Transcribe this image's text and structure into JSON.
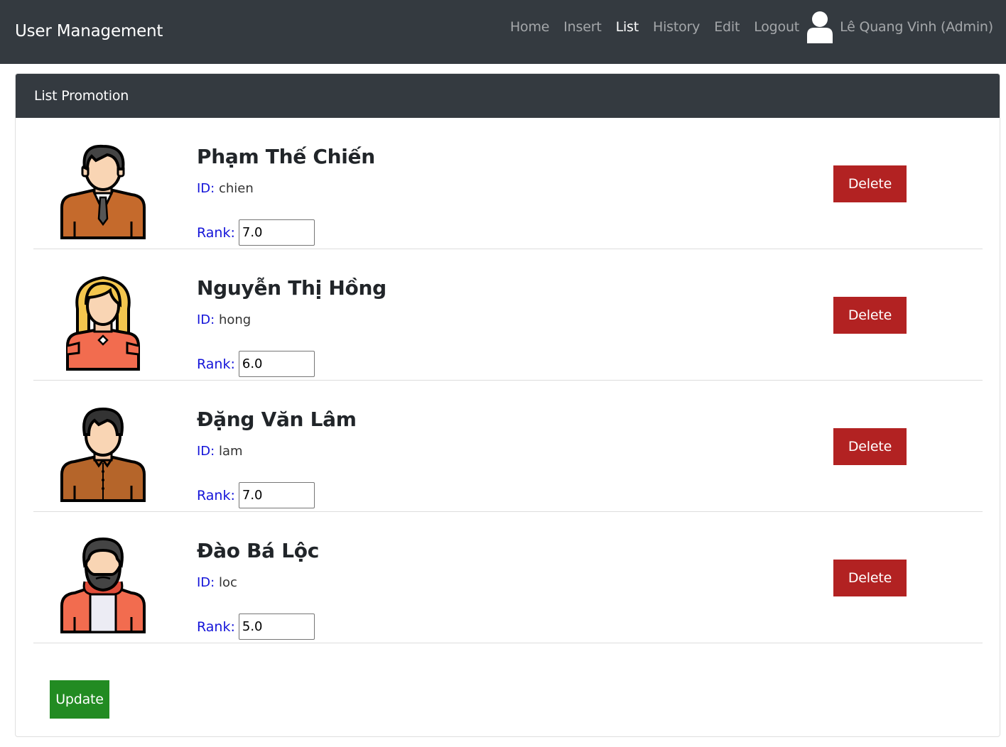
{
  "navbar": {
    "brand": "User Management",
    "links": [
      "Home",
      "Insert",
      "List",
      "History",
      "Edit",
      "Logout"
    ],
    "active_link": "List",
    "user_icon": "user-icon",
    "user_name": "Lê Quang Vinh (Admin)"
  },
  "card": {
    "title": "List Promotion"
  },
  "labels": {
    "id": "ID:",
    "rank": "Rank:",
    "delete": "Delete",
    "update": "Update"
  },
  "users": [
    {
      "name": "Phạm Thế Chiến",
      "id": "chien",
      "rank": "7.0",
      "avatar": "man-suit-tie-avatar-icon"
    },
    {
      "name": "Nguyễn Thị Hồng",
      "id": "hong",
      "rank": "6.0",
      "avatar": "woman-blonde-avatar-icon"
    },
    {
      "name": "Đặng Văn Lâm",
      "id": "lam",
      "rank": "7.0",
      "avatar": "man-shirt-avatar-icon"
    },
    {
      "name": "Đào Bá Lộc",
      "id": "loc",
      "rank": "5.0",
      "avatar": "man-beard-hoodie-avatar-icon"
    }
  ],
  "colors": {
    "navbar_bg": "#343a40",
    "delete_button": "#b22222",
    "update_button": "#228b22",
    "label_blue": "#1414d9"
  }
}
